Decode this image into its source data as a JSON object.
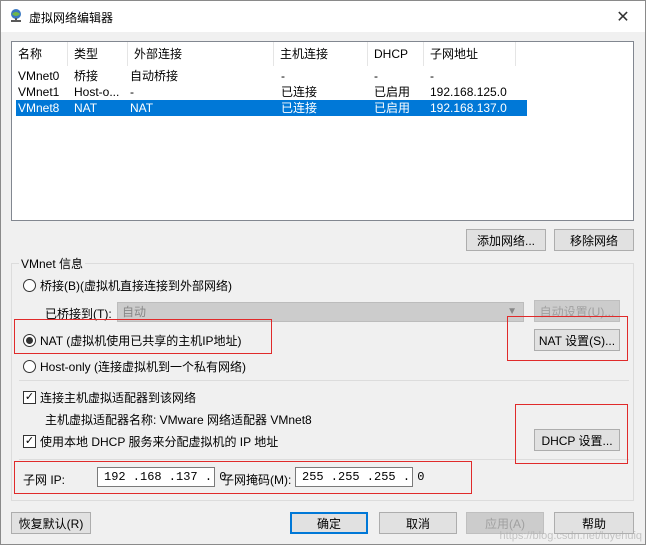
{
  "window": {
    "title": "虚拟网络编辑器",
    "close_glyph": "✕"
  },
  "networks": {
    "columns": [
      "名称",
      "类型",
      "外部连接",
      "主机连接",
      "DHCP",
      "子网地址"
    ],
    "rows": [
      {
        "name": "VMnet0",
        "type": "桥接",
        "external": "自动桥接",
        "host": "-",
        "dhcp": "-",
        "subnet": "-",
        "selected": false
      },
      {
        "name": "VMnet1",
        "type": "Host-o...",
        "external": "-",
        "host": "已连接",
        "dhcp": "已启用",
        "subnet": "192.168.125.0",
        "selected": false
      },
      {
        "name": "VMnet8",
        "type": "NAT",
        "external": "NAT",
        "host": "已连接",
        "dhcp": "已启用",
        "subnet": "192.168.137.0",
        "selected": true
      }
    ]
  },
  "list_buttons": {
    "add": "添加网络...",
    "remove": "移除网络"
  },
  "info": {
    "group_title": "VMnet 信息",
    "bridge_radio": "桥接(B)(虚拟机直接连接到外部网络)",
    "bridged_to_label": "已桥接到(T):",
    "bridged_to_value": "自动",
    "auto_settings": "自动设置(U)...",
    "nat_radio": "NAT (虚拟机使用已共享的主机IP地址)",
    "nat_settings": "NAT 设置(S)...",
    "hostonly_radio": "Host-only (连接虚拟机到一个私有网络)",
    "connect_adapter": "连接主机虚拟适配器到该网络",
    "adapter_name": "主机虚拟适配器名称: VMware 网络适配器 VMnet8",
    "use_dhcp": "使用本地 DHCP 服务来分配虚拟机的 IP 地址",
    "dhcp_settings": "DHCP 设置...",
    "subnet_ip_label": "子网 IP:",
    "subnet_ip": "192 .168 .137 . 0",
    "subnet_mask_label": "子网掩码(M):",
    "subnet_mask": "255 .255 .255 . 0"
  },
  "footer": {
    "restore": "恢复默认(R)",
    "ok": "确定",
    "cancel": "取消",
    "apply": "应用(A)",
    "help": "帮助"
  },
  "watermark": "https://blog.csdn.net/luyehuiq",
  "colors": {
    "selection": "#0078d7",
    "annotation": "#e02a2a"
  }
}
